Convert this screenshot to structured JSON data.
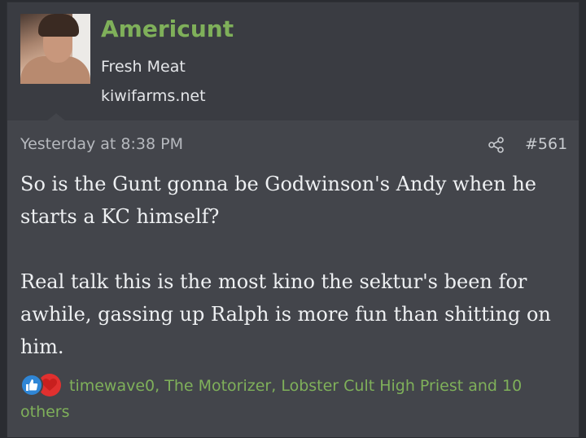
{
  "user": {
    "name": "Americunt",
    "title": "Fresh Meat",
    "site": "kiwifarms.net"
  },
  "post": {
    "date": "Yesterday at 8:38 PM",
    "number": "#561",
    "paragraphs": [
      "So is the Gunt gonna be Godwinson's Andy when he starts a KC himself?",
      "Real talk this is the most kino the sektur's been for awhile, gassing up Ralph is more fun than shitting on him."
    ]
  },
  "reactions": {
    "icons": [
      "like-icon",
      "love-icon"
    ],
    "text": "timewave0, The Motorizer, Lobster Cult High Priest and 10 others"
  },
  "colors": {
    "username": "#7fb05a",
    "post_bg": "#43454b",
    "header_bg": "#3a3c42",
    "like": "#2f86d6",
    "love": "#e0302f"
  }
}
